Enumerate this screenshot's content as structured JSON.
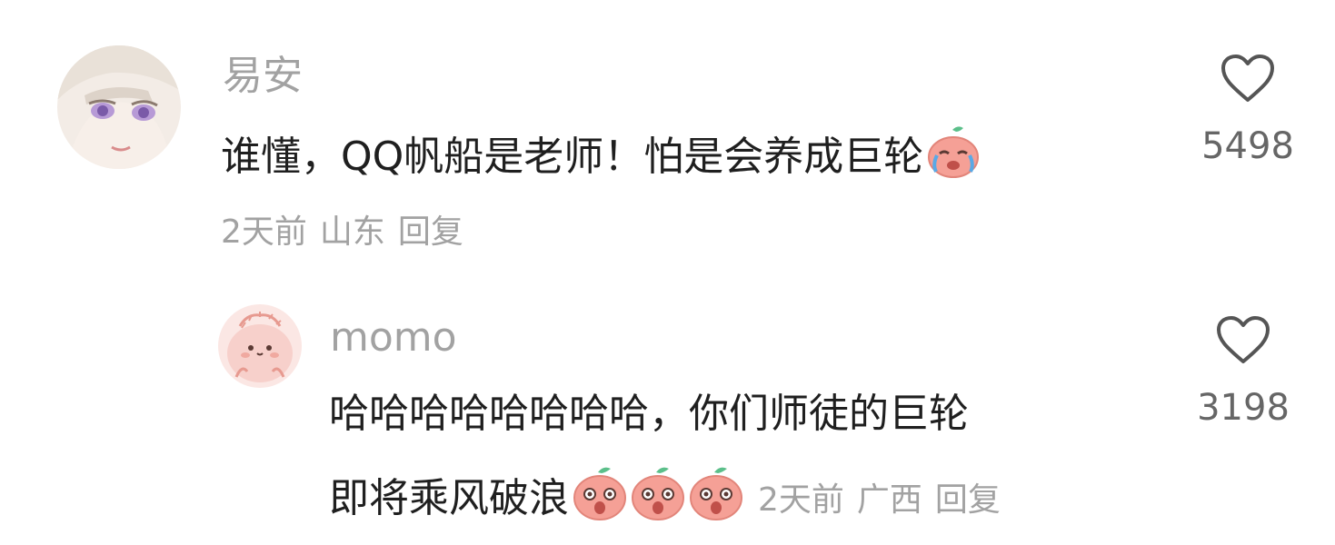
{
  "comments": [
    {
      "username": "易安",
      "text": "谁懂，QQ帆船是老师！怕是会养成巨轮",
      "emoji": "crying-peach-emoji",
      "time": "2天前",
      "location": "山东",
      "reply_label": "回复",
      "likes": "5498",
      "icon": "heart-outline-icon"
    },
    {
      "username": "momo",
      "text_line1": "哈哈哈哈哈哈哈哈，你们师徒的巨轮",
      "text_line2": "即将乘风破浪",
      "emoji": "shocked-peach-emoji",
      "emoji_count": 3,
      "time": "2天前",
      "location": "广西",
      "reply_label": "回复",
      "likes": "3198",
      "icon": "heart-outline-icon"
    }
  ],
  "colors": {
    "text": "#1f1f1f",
    "meta": "#a2a2a2",
    "heart": "#555555",
    "emoji_body": "#f5a096",
    "emoji_leaf": "#5bbf8a"
  }
}
